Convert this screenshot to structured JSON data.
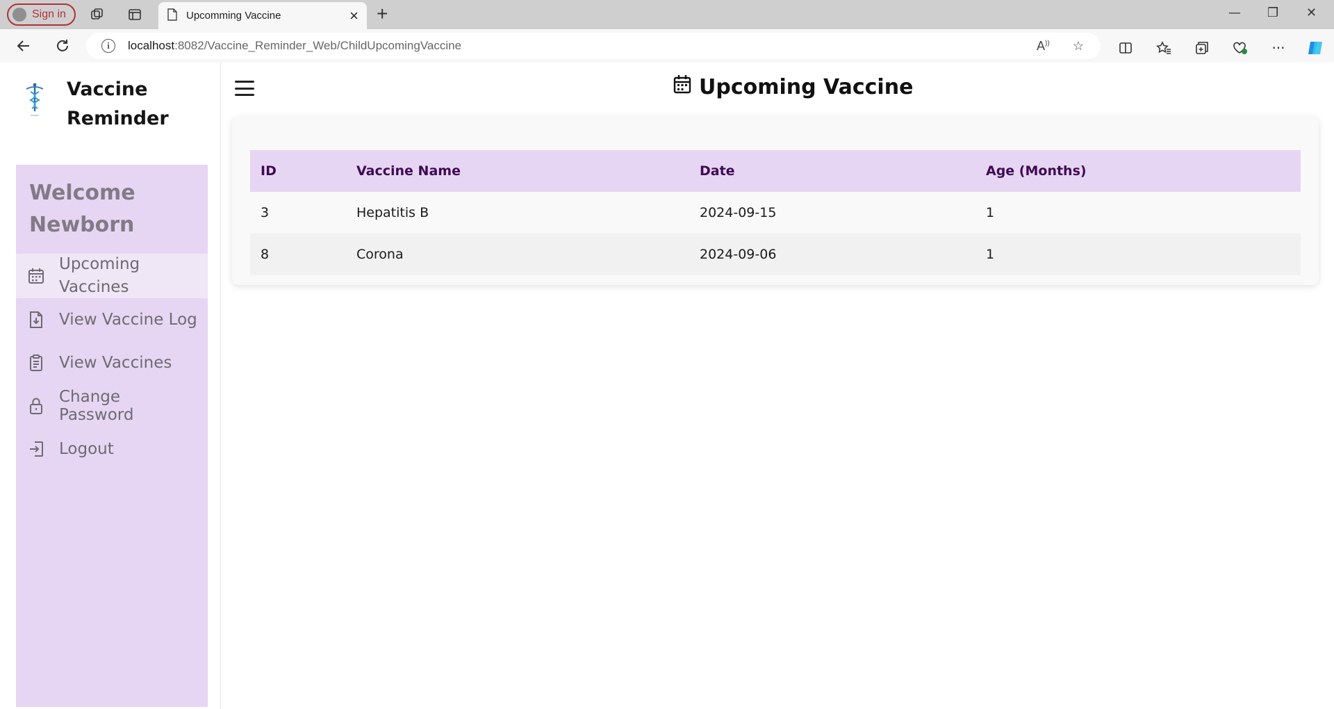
{
  "browser": {
    "signin_label": "Sign in",
    "tab_title": "Upcomming Vaccine",
    "url_host": "localhost",
    "url_rest": ":8082/Vaccine_Reminder_Web/ChildUpcomingVaccine"
  },
  "sidebar": {
    "brand_line1": "Vaccine",
    "brand_line2": "Reminder",
    "welcome_line1": "Welcome",
    "welcome_line2": "Newborn",
    "items": [
      {
        "label_line1": "Upcoming",
        "label_line2": "Vaccines",
        "icon": "calendar-icon",
        "active": true
      },
      {
        "label": "View Vaccine Log",
        "icon": "file-download-icon"
      },
      {
        "label": "View Vaccines",
        "icon": "clipboard-icon"
      },
      {
        "label": "Change Password",
        "icon": "lock-icon"
      },
      {
        "label": "Logout",
        "icon": "logout-icon"
      }
    ]
  },
  "main": {
    "title": "Upcoming Vaccine",
    "table": {
      "headers": [
        "ID",
        "Vaccine Name",
        "Date",
        "Age (Months)"
      ],
      "rows": [
        [
          "3",
          "Hepatitis B",
          "2024-09-15",
          "1"
        ],
        [
          "8",
          "Corona",
          "2024-09-06",
          "1"
        ]
      ]
    }
  },
  "colors": {
    "sidebar_panel": "#e6d6f3",
    "header_text": "#3e0b52",
    "menu_text": "#6f6a72",
    "welcome_text": "#837a88"
  }
}
